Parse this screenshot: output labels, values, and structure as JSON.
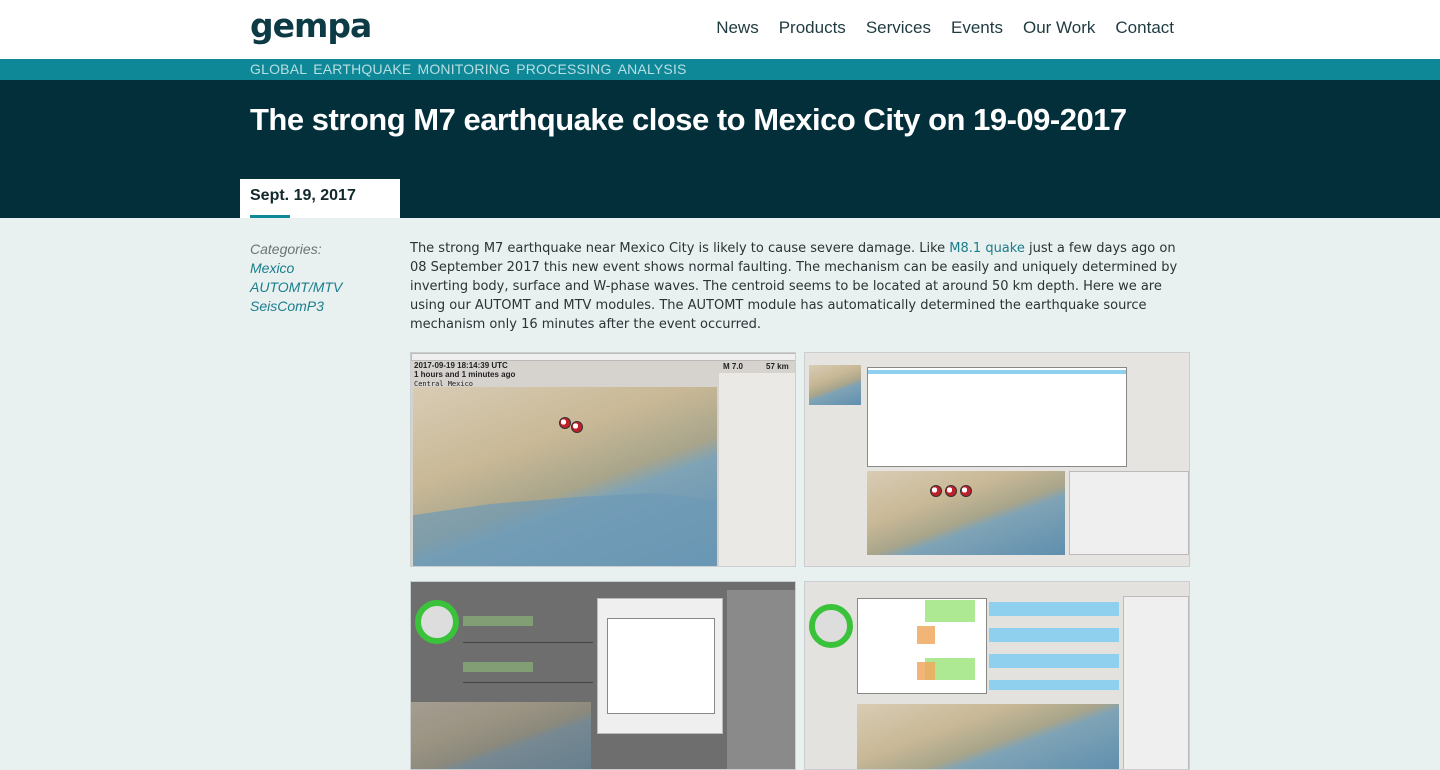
{
  "header": {
    "logo": "gempa",
    "nav": [
      "News",
      "Products",
      "Services",
      "Events",
      "Our Work",
      "Contact"
    ]
  },
  "tagline": [
    "GLOBAL",
    "EARTHQUAKE",
    "MONITORING",
    "PROCESSING",
    "ANALYSIS"
  ],
  "hero": {
    "title": "The strong M7 earthquake close to Mexico City on 19-09-2017"
  },
  "date": "Sept. 19, 2017",
  "categories": {
    "label": "Categories:",
    "items": [
      "Mexico",
      "AUTOMT/MTV",
      "SeisComP3"
    ]
  },
  "article": {
    "before_link": "The strong M7 earthquake near Mexico City is likely to cause severe damage. Like ",
    "link": "M8.1 quake",
    "after_link": " just a few days ago on 08 September 2017 this new event shows normal faulting. The mechanism can be easily and uniquely determined by inverting body, surface and W-phase waves. The centroid seems to be located at around 50 km depth. Here we are using our AUTOMT and MTV modules. The AUTOMT module has automatically determined the earthquake source mechanism only 16 minutes after the event occurred."
  },
  "screenshot1": {
    "time": "2017-09-19 18:14:39 UTC",
    "ago": "1 hours and 1 minutes ago",
    "region": "Central Mexico",
    "mag": "M 7.0",
    "depth": "57 km"
  },
  "colors": {
    "teal": "#0e8797",
    "dark": "#022f3a",
    "link": "#1a7e8c"
  }
}
